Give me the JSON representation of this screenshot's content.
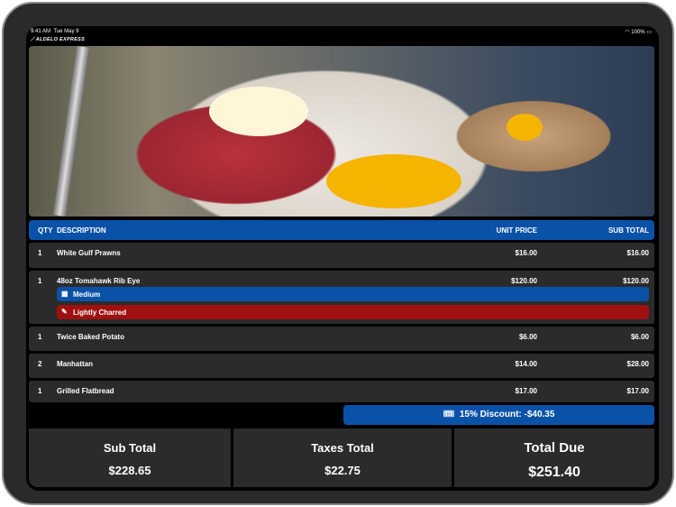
{
  "status": {
    "time": "9:41 AM",
    "date": "Tue May 9",
    "battery": "100%"
  },
  "brand": "ALDELO EXPRESS",
  "header": {
    "qty": "QTY",
    "description": "DESCRIPTION",
    "unit_price": "UNIT PRICE",
    "sub_total": "SUB TOTAL"
  },
  "items": [
    {
      "qty": "1",
      "description": "White Gulf Prawns",
      "unit_price": "$16.00",
      "sub_total": "$16.00"
    },
    {
      "qty": "1",
      "description": "48oz Tomahawk Rib Eye",
      "unit_price": "$120.00",
      "sub_total": "$120.00",
      "modifiers": [
        {
          "label": "Medium",
          "color": "#0a52a8"
        },
        {
          "label": "Lightly Charred",
          "color": "#a01010"
        }
      ]
    },
    {
      "qty": "1",
      "description": "Twice Baked Potato",
      "unit_price": "$6.00",
      "sub_total": "$6.00"
    },
    {
      "qty": "2",
      "description": "Manhattan",
      "unit_price": "$14.00",
      "sub_total": "$28.00"
    },
    {
      "qty": "1",
      "description": "Grilled Flatbread",
      "unit_price": "$17.00",
      "sub_total": "$17.00"
    }
  ],
  "discount": "15% Discount: -$40.35",
  "totals": {
    "sub_total_label": "Sub Total",
    "sub_total": "$228.65",
    "taxes_label": "Taxes Total",
    "taxes": "$22.75",
    "due_label": "Total Due",
    "due": "$251.40"
  }
}
